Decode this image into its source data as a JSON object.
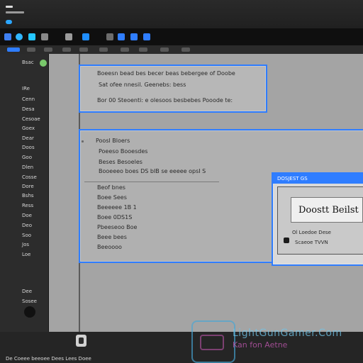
{
  "theme": {
    "accent": "#2f7dff",
    "sidebar_bg": "#2c2c2c",
    "canvas_bg": "#a4a4a4"
  },
  "sidebar": {
    "items": [
      {
        "label": "Bsac"
      },
      {
        "label": "IRe"
      },
      {
        "label": "Cenn"
      },
      {
        "label": "Desa"
      },
      {
        "label": "Cesoae"
      },
      {
        "label": "Goex"
      },
      {
        "label": "Dear"
      },
      {
        "label": "Doos"
      },
      {
        "label": "Goo"
      },
      {
        "label": "Dlen"
      },
      {
        "label": "Cosse"
      },
      {
        "label": "Dore"
      },
      {
        "label": "Bshs"
      },
      {
        "label": "Ress"
      },
      {
        "label": "Doe"
      },
      {
        "label": "Deo"
      },
      {
        "label": "Soo"
      },
      {
        "label": "Jos"
      },
      {
        "label": "Loe"
      },
      {
        "label": "Dee"
      },
      {
        "label": "Sosee"
      }
    ]
  },
  "panels": {
    "top": {
      "lines": [
        "Boeesn bead bes becer beas bebergee of Doobe",
        "Sat ofee nnesil. Geenebs: bess",
        "Bor 00 Steoenti: e olesoos besbebes Pooode te:"
      ]
    },
    "main": {
      "lines": [
        "Poosl Bloers",
        "Poeeso Booesdes",
        "Beses Besoeles",
        "Booeeeo boes DS bIB se eeeee opsI S"
      ],
      "lines2": [
        "Beof bnes",
        "Boee Sees",
        "Beeeeee 1B 1",
        "Boee 0DS1S",
        "Pbeeseoo Boe",
        "Beee bees",
        "Beeoooo"
      ]
    },
    "dialog": {
      "title": "DOSJEST GS",
      "heading": "Doostt Beilst",
      "line1": "Ol Loedoe Dese",
      "line2": "Scaeoe TVVN"
    }
  },
  "statusbar": {
    "text": "De  Coeee beeoee  Dees  Lees  Doee"
  },
  "watermark": {
    "line1": "LightGunGamer.Com",
    "line2": "Kan fon Aetne"
  }
}
